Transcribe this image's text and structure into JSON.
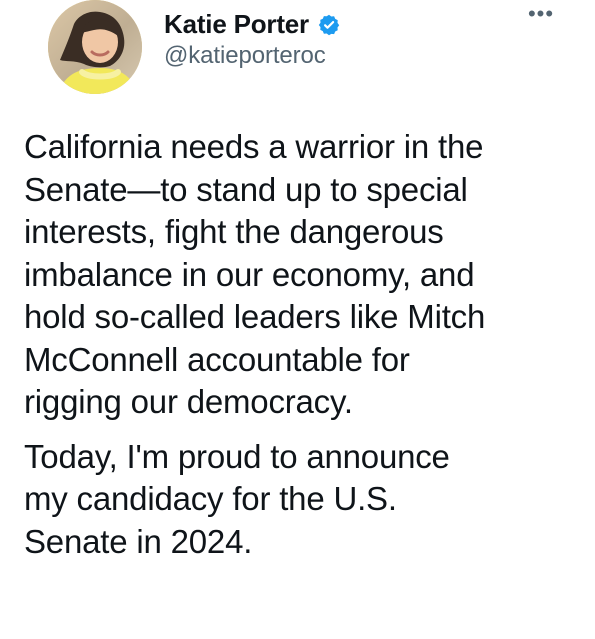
{
  "tweet": {
    "author": {
      "display_name": "Katie Porter",
      "handle": "@katieporteroc",
      "verified": true,
      "verified_color": "#1d9bf0"
    },
    "more_label": "•••",
    "paragraphs": [
      "California needs a warrior in the\nSenate—to stand up to special\ninterests, fight the dangerous\nimbalance in our economy, and\nhold so-called leaders like Mitch\nMcConnell accountable for\nrigging our democracy.",
      "Today, I'm proud to announce\nmy candidacy for the U.S.\nSenate in 2024."
    ]
  }
}
